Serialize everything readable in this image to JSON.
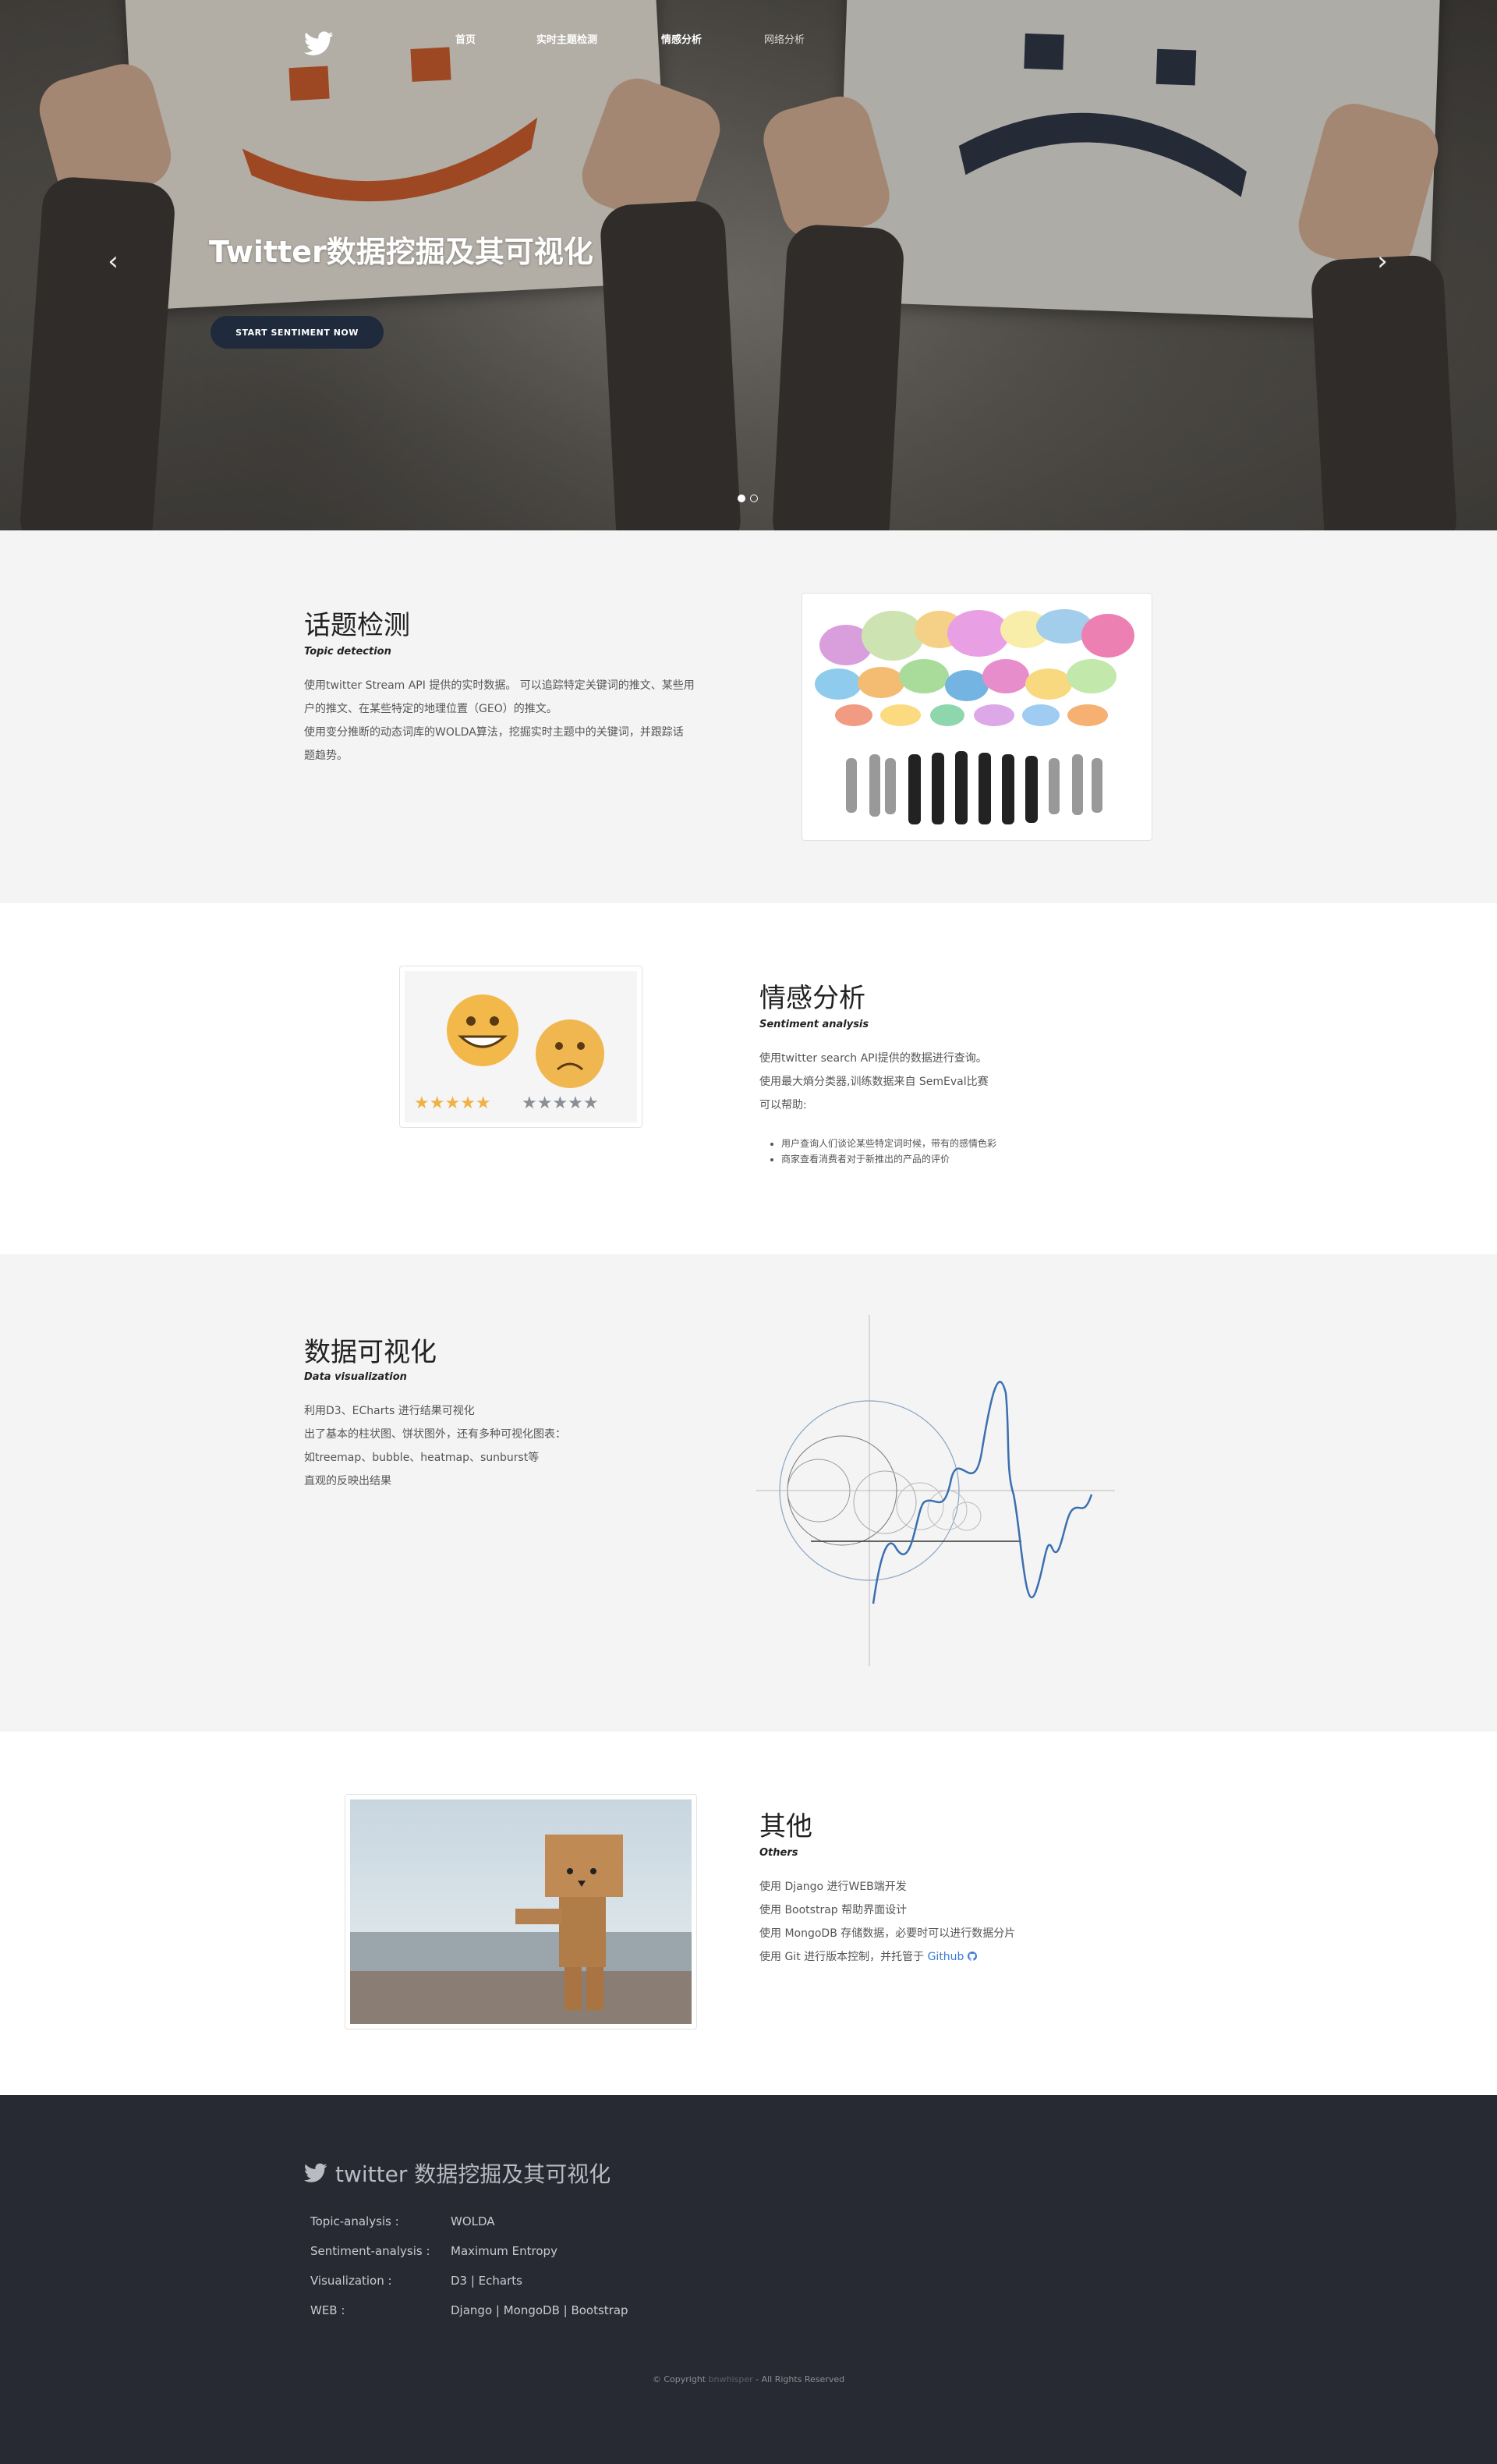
{
  "nav": {
    "items": [
      {
        "label": "首页"
      },
      {
        "label": "实时主题检测"
      },
      {
        "label": "情感分析"
      },
      {
        "label": "网络分析"
      }
    ]
  },
  "hero": {
    "title": "Twitter数据挖掘及其可视化",
    "button_label": "START SENTIMENT NOW",
    "slides": 2,
    "active_slide": 1
  },
  "sections": {
    "topic": {
      "title": "话题检测",
      "subtitle": "Topic detection",
      "lines": [
        "使用twitter Stream API 提供的实时数据。 可以追踪特定关键词的推文、某些用",
        "户的推文、在某些特定的地理位置（GEO）的推文。",
        "使用变分推断的动态词库的WOLDA算法，挖掘实时主题中的关键词，并跟踪话",
        "题趋势。"
      ]
    },
    "sentiment": {
      "title": "情感分析",
      "subtitle": "Sentiment analysis",
      "lines": [
        "使用twitter search API提供的数据进行查询。",
        "使用最大熵分类器,训练数据来自 SemEval比赛",
        "可以帮助:"
      ],
      "bullets": [
        "用户查询人们谈论某些特定词时候，带有的感情色彩",
        "商家查看消费者对于新推出的产品的评价"
      ]
    },
    "visualization": {
      "title": "数据可视化",
      "subtitle": "Data visualization",
      "lines": [
        "利用D3、ECharts 进行结果可视化",
        "出了基本的柱状图、饼状图外，还有多种可视化图表：",
        "如treemap、bubble、heatmap、sunburst等",
        "直观的反映出结果"
      ]
    },
    "others": {
      "title": "其他",
      "subtitle": "Others",
      "lines": [
        "使用 Django 进行WEB端开发",
        "使用 Bootstrap 帮助界面设计",
        "使用 MongoDB 存储数据，必要时可以进行数据分片"
      ],
      "git_prefix": "使用 Git 进行版本控制，并托管于 ",
      "git_link": "Github"
    }
  },
  "footer": {
    "brand": "twitter 数据挖掘及其可视化",
    "rows": [
      {
        "label": "Topic-analysis :",
        "value": "WOLDA"
      },
      {
        "label": "Sentiment-analysis :",
        "value": "Maximum Entropy"
      },
      {
        "label": "Visualization :",
        "value": "D3 | Echarts"
      },
      {
        "label": "WEB :",
        "value": "Django | MongoDB | Bootstrap"
      }
    ],
    "copyright_prefix": "© Copyright ",
    "copyright_name": "bnwhisper",
    "copyright_suffix": " - All Rights Reserved"
  },
  "colors": {
    "accent_button": "#1f2a3d",
    "footer_bg": "#282a33",
    "section_gray": "#f4f4f4",
    "link": "#3a7bd5"
  },
  "icons": {
    "logo": "twitter-bird-icon",
    "prev": "chevron-left-icon",
    "next": "chevron-right-icon",
    "github": "github-icon"
  }
}
